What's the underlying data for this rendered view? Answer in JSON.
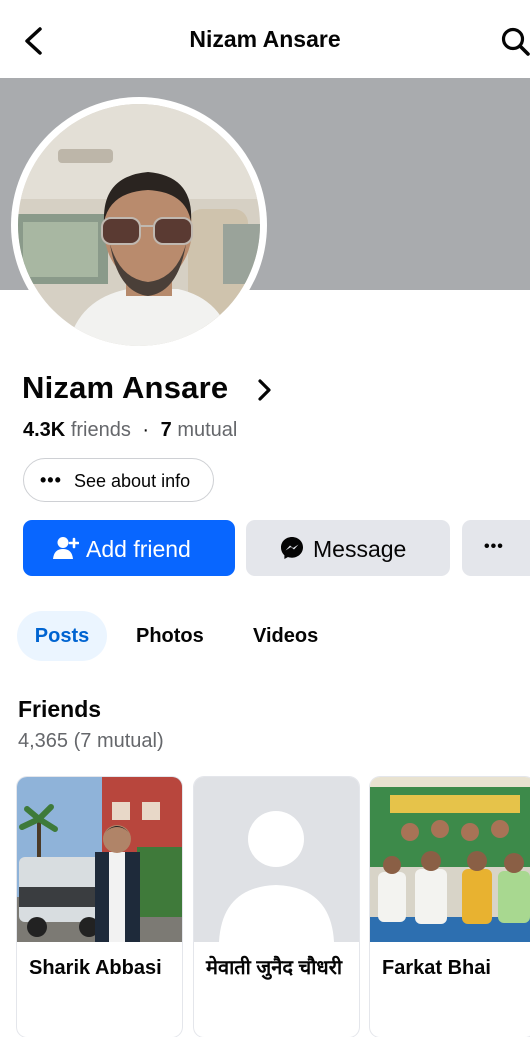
{
  "header": {
    "title": "Nizam Ansare",
    "back_icon": "back-arrow-icon",
    "search_icon": "search-icon"
  },
  "profile": {
    "name": "Nizam Ansare",
    "friends_count": "4.3K",
    "friends_label": "friends",
    "separator": "·",
    "mutual_count": "7",
    "mutual_label": "mutual"
  },
  "about_button": {
    "label": "See about info"
  },
  "actions": {
    "add_friend": "Add friend",
    "message": "Message",
    "more_icon": "more-dots-icon",
    "accent": "#0866ff"
  },
  "tabs": [
    {
      "label": "Posts",
      "selected": true
    },
    {
      "label": "Photos",
      "selected": false
    },
    {
      "label": "Videos",
      "selected": false
    }
  ],
  "friends_section": {
    "title": "Friends",
    "count": "4,365 (7 mutual)",
    "cards": [
      {
        "name": "Sharik Abbasi"
      },
      {
        "name": "मेवाती जुनैद चौधरी"
      },
      {
        "name": "Farkat Bhai"
      }
    ]
  }
}
